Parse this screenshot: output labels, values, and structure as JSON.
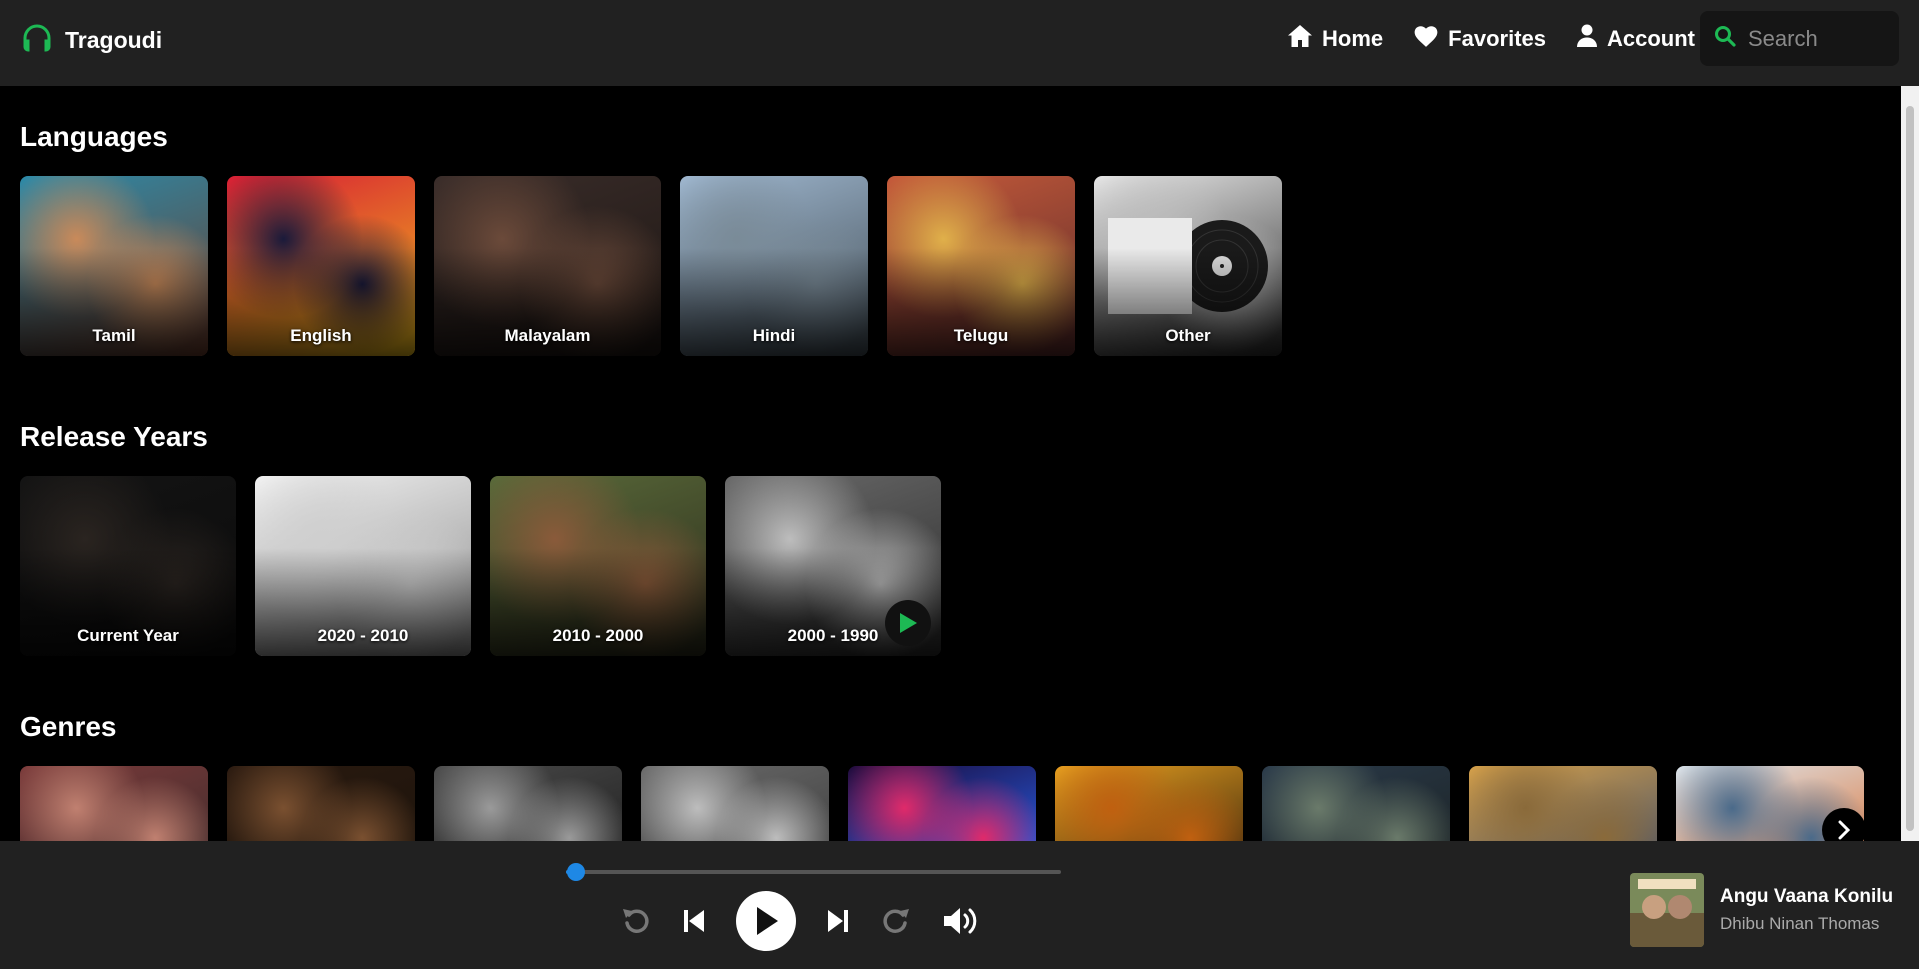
{
  "app": {
    "brand": "Tragoudi",
    "accent": "#1db954"
  },
  "nav": {
    "home": "Home",
    "favorites": "Favorites",
    "account": "Account"
  },
  "search": {
    "placeholder": "Search"
  },
  "sections": {
    "languages": "Languages",
    "years": "Release Years",
    "genres": "Genres"
  },
  "languages": [
    {
      "label": "Tamil",
      "colors": [
        "#2d8aa8",
        "#c98a5a",
        "#6b3b2a"
      ]
    },
    {
      "label": "English",
      "colors": [
        "#d71f35",
        "#1a1a3a",
        "#f2c21a"
      ]
    },
    {
      "label": "Malayalam",
      "colors": [
        "#3a2d2a",
        "#6b4a3a",
        "#1c1512"
      ]
    },
    {
      "label": "Hindi",
      "colors": [
        "#9fb7cf",
        "#7a8b98",
        "#3f4a52"
      ]
    },
    {
      "label": "Telugu",
      "colors": [
        "#c55a3a",
        "#e0b04a",
        "#5a2a2a"
      ]
    },
    {
      "label": "Other",
      "colors": [
        "#e6e6e6",
        "#bdbdbd",
        "#2a2a2a"
      ]
    }
  ],
  "years": [
    {
      "label": "Current Year",
      "colors": [
        "#141414",
        "#2a2420",
        "#0a0a0a"
      ]
    },
    {
      "label": "2020 - 2010",
      "colors": [
        "#f2f2f2",
        "#cfcfcf",
        "#8a8a8a"
      ]
    },
    {
      "label": "2010 - 2000",
      "colors": [
        "#5a6a3a",
        "#8a5a3a",
        "#2a2a1a"
      ]
    },
    {
      "label": "2000 - 1990",
      "colors": [
        "#6a6a6a",
        "#bdbdbd",
        "#2a2a2a"
      ]
    }
  ],
  "genres": [
    {
      "label": "",
      "colors": [
        "#7a3a3a",
        "#c08070",
        "#3a2a2a"
      ]
    },
    {
      "label": "",
      "colors": [
        "#2a1a10",
        "#7a5030",
        "#1a120a"
      ]
    },
    {
      "label": "",
      "colors": [
        "#4a4a4a",
        "#9a9a9a",
        "#1a1a1a"
      ]
    },
    {
      "label": "",
      "colors": [
        "#6a6a6a",
        "#bdbdbd",
        "#3a3a3a"
      ]
    },
    {
      "label": "",
      "colors": [
        "#1a0a3a",
        "#e02a6a",
        "#2a6aff"
      ]
    },
    {
      "label": "",
      "colors": [
        "#e8a020",
        "#c06010",
        "#2a1a0a"
      ]
    },
    {
      "label": "",
      "colors": [
        "#2a3a4a",
        "#6a7a6a",
        "#1a2020"
      ]
    },
    {
      "label": "",
      "colors": [
        "#d8a24a",
        "#8a6a3a",
        "#3a4a6a"
      ]
    },
    {
      "label": "",
      "colors": [
        "#dfe8ef",
        "#4a6a8a",
        "#d86a2a"
      ]
    }
  ],
  "player": {
    "progress": 0.02,
    "title": "Angu Vaana Konilu",
    "artist": "Dhibu Ninan Thomas"
  }
}
